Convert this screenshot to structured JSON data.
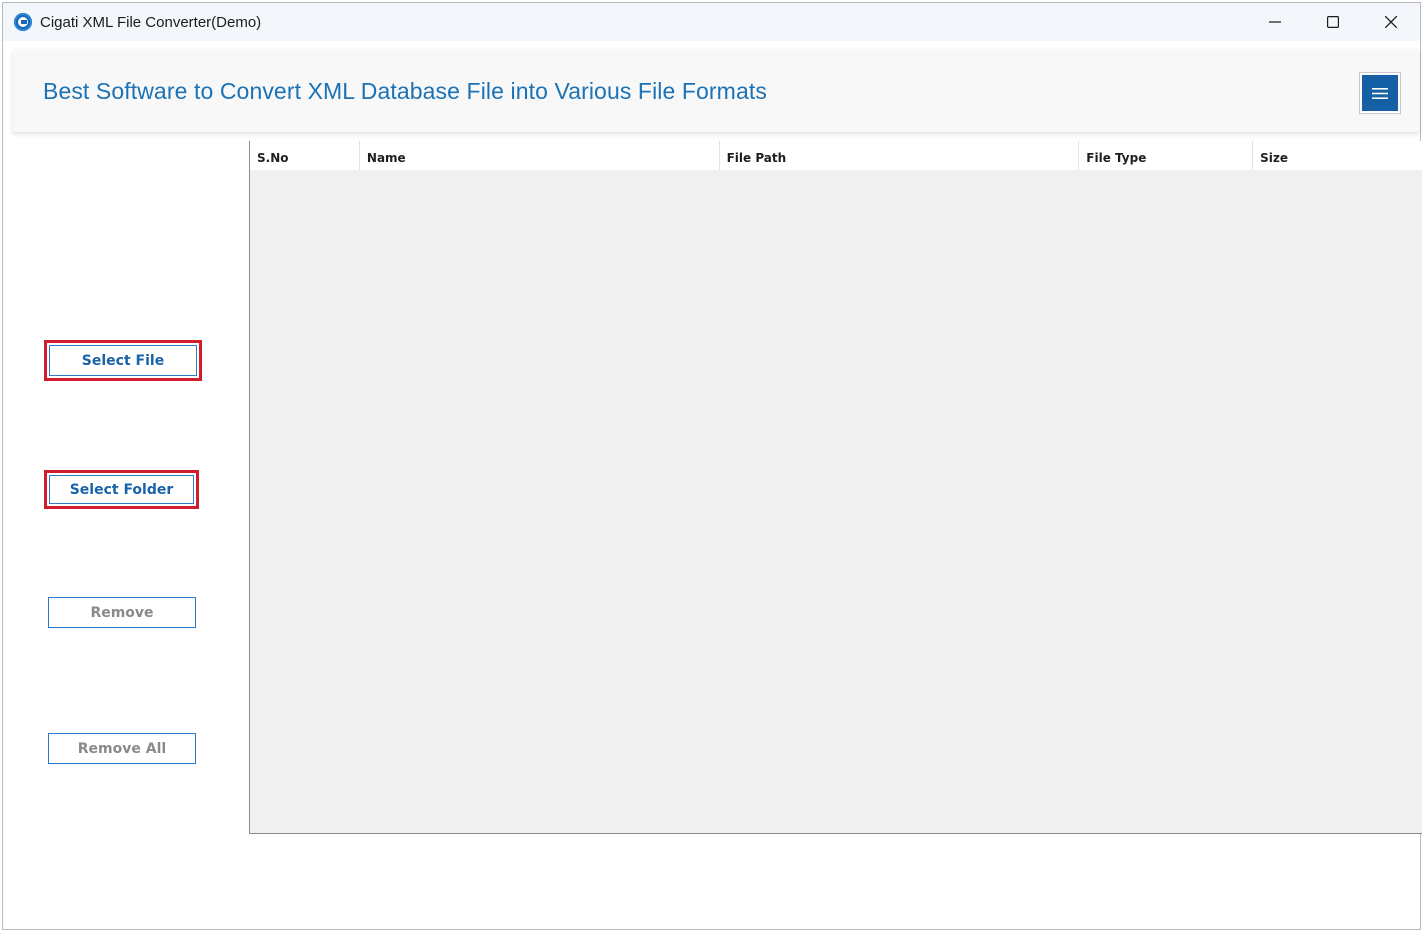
{
  "window": {
    "title": "Cigati XML File Converter(Demo)",
    "controls": [
      "minimize-icon",
      "maximize-icon",
      "close-icon"
    ]
  },
  "banner": {
    "title": "Best Software to Convert XML Database File into Various File Formats",
    "menu_icon": "hamburger-menu-icon"
  },
  "sidebar": {
    "select_file": "Select File",
    "select_folder": "Select Folder",
    "remove": "Remove",
    "remove_all": "Remove All"
  },
  "table": {
    "columns": [
      "S.No",
      "Name",
      "File Path",
      "File Type",
      "Size"
    ],
    "rows": []
  },
  "colors": {
    "accent": "#1b72b5",
    "menu_button": "#1560a5",
    "highlight": "#d01d2c",
    "disabled_text": "#8a8a8a"
  }
}
